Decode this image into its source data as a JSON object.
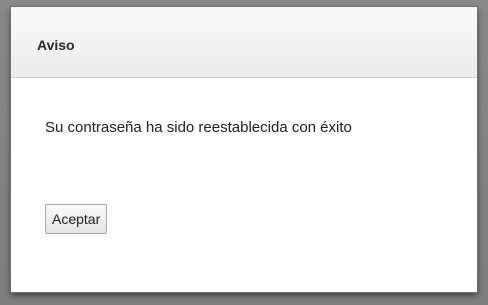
{
  "dialog": {
    "title": "Aviso",
    "message": "Su contraseña ha sido reestablecida con éxito",
    "accept_label": "Aceptar"
  }
}
